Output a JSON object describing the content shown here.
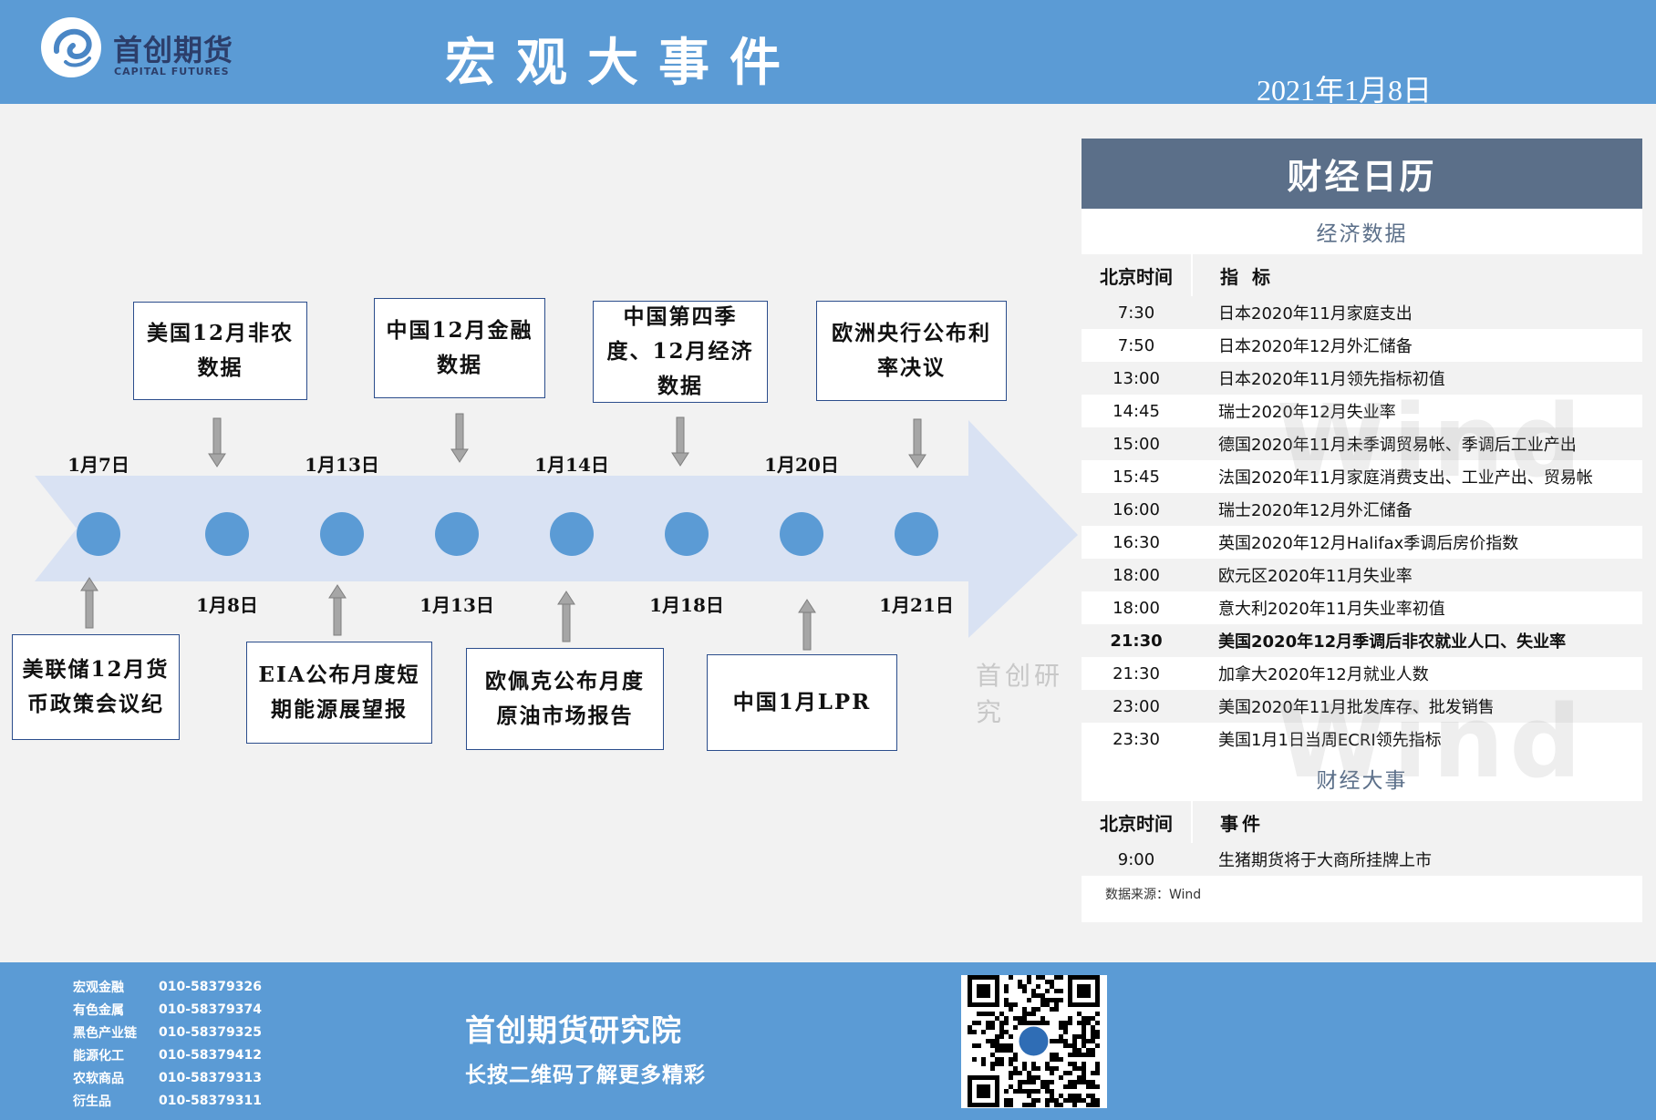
{
  "header": {
    "logo_cn": "首创期货",
    "logo_en": "CAPITAL FUTURES",
    "title": "宏观大事件",
    "date": "2021年1月8日"
  },
  "timeline": {
    "top_dates": [
      "1月7日",
      "1月13日",
      "1月14日",
      "1月20日"
    ],
    "bottom_dates": [
      "1月8日",
      "1月13日",
      "1月18日",
      "1月21日"
    ],
    "top_events": [
      {
        "text": "美国12月非农数据"
      },
      {
        "text": "中国12月金融数据"
      },
      {
        "text": "中国第四季度、12月经济数据"
      },
      {
        "text": "欧洲央行公布利率决议"
      }
    ],
    "bottom_events": [
      {
        "text": "美联储12月货币政策会议纪"
      },
      {
        "text": "EIA公布月度短期能源展望报"
      },
      {
        "text": "欧佩克公布月度原油市场报告"
      },
      {
        "text": "中国1月LPR"
      }
    ],
    "watermark": "首创研究"
  },
  "calendar": {
    "title": "财经日历",
    "econ_section": "经济数据",
    "col_time": "北京时间",
    "col_indicator": "指 标",
    "econ_rows": [
      {
        "time": "7:30",
        "item": "日本2020年11月家庭支出",
        "bold": false
      },
      {
        "time": "7:50",
        "item": "日本2020年12月外汇储备",
        "bold": false
      },
      {
        "time": "13:00",
        "item": "日本2020年11月领先指标初值",
        "bold": false
      },
      {
        "time": "14:45",
        "item": "瑞士2020年12月失业率",
        "bold": false
      },
      {
        "time": "15:00",
        "item": "德国2020年11月未季调贸易帐、季调后工业产出",
        "bold": false
      },
      {
        "time": "15:45",
        "item": "法国2020年11月家庭消费支出、工业产出、贸易帐",
        "bold": false
      },
      {
        "time": "16:00",
        "item": "瑞士2020年12月外汇储备",
        "bold": false
      },
      {
        "time": "16:30",
        "item": "英国2020年12月Halifax季调后房价指数",
        "bold": false
      },
      {
        "time": "18:00",
        "item": "欧元区2020年11月失业率",
        "bold": false
      },
      {
        "time": "18:00",
        "item": "意大利2020年11月失业率初值",
        "bold": false
      },
      {
        "time": "21:30",
        "item": "美国2020年12月季调后非农就业人口、失业率",
        "bold": true
      },
      {
        "time": "21:30",
        "item": "加拿大2020年12月就业人数",
        "bold": false
      },
      {
        "time": "23:00",
        "item": "美国2020年11月批发库存、批发销售",
        "bold": false
      },
      {
        "time": "23:30",
        "item": "美国1月1日当周ECRI领先指标",
        "bold": false
      }
    ],
    "event_section": "财经大事",
    "col_event": "事件",
    "event_rows": [
      {
        "time": "9:00",
        "item": "生猪期货将于大商所挂牌上市"
      }
    ],
    "source": "数据来源：Wind",
    "watermark": "Wind"
  },
  "footer": {
    "contacts": [
      {
        "dept": "宏观金融",
        "phone": "010-58379326"
      },
      {
        "dept": "有色金属",
        "phone": "010-58379374"
      },
      {
        "dept": "黑色产业链",
        "phone": "010-58379325"
      },
      {
        "dept": "能源化工",
        "phone": "010-58379412"
      },
      {
        "dept": "农软商品",
        "phone": "010-58379313"
      },
      {
        "dept": "衍生品",
        "phone": "010-58379311"
      }
    ],
    "org_name": "首创期货研究院",
    "org_sub": "长按二维码了解更多精彩"
  },
  "colors": {
    "header_blue": "#5b9bd5",
    "arrow": "#d9e2f3",
    "dot": "#5b9bd5",
    "cal_head": "#5b6f89"
  }
}
